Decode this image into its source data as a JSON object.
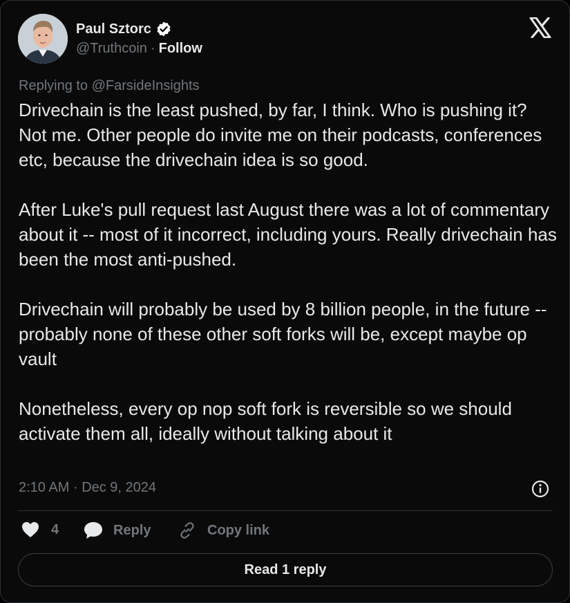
{
  "author": {
    "name": "Paul Sztorc",
    "handle": "@Truthcoin",
    "separator": "·",
    "follow_label": "Follow",
    "verified_icon": "verified-badge-icon"
  },
  "brand": {
    "logo": "x-logo-icon"
  },
  "tweet": {
    "replying_prefix": "Replying to",
    "replying_to": "@FarsideInsights",
    "paragraphs": [
      "Drivechain is the least pushed, by far, I think. Who is pushing it? Not me. Other people do invite me on their podcasts, conferences etc, because the drivechain idea is so good.",
      "After Luke's pull request last August there was a lot of commentary about it -- most of it incorrect, including yours. Really drivechain has been the most anti-pushed.",
      "Drivechain will probably be used by 8 billion people, in the future -- probably none of these other soft forks will be, except maybe op vault",
      "Nonetheless, every op nop soft fork is reversible so we should activate them all, ideally without talking about it"
    ],
    "time": "2:10 AM",
    "date_separator": "·",
    "date": "Dec 9, 2024"
  },
  "actions": {
    "like_count": "4",
    "reply_label": "Reply",
    "copy_link_label": "Copy link",
    "read_replies_label": "Read 1 reply"
  },
  "colors": {
    "background": "#0a0a0a",
    "text": "#e7e9ea",
    "muted": "#71767b",
    "border": "#2f3336",
    "verified": "#ffffff"
  }
}
